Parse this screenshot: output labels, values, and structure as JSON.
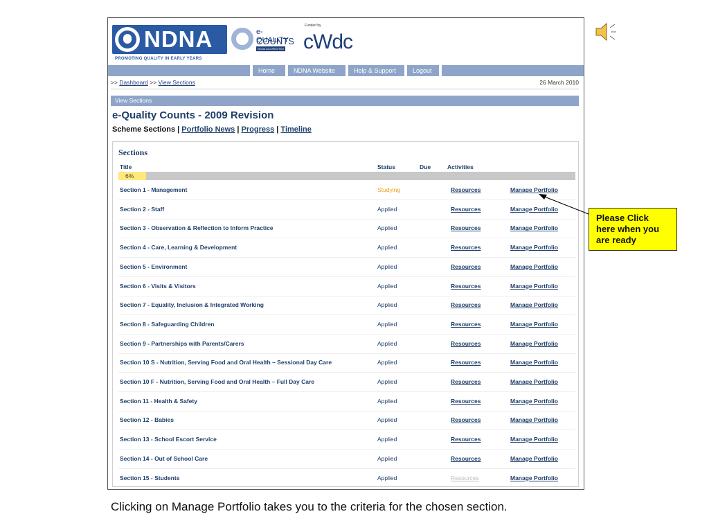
{
  "logos": {
    "ndna_text": "NDNA",
    "ndna_tagline": "PROMOTING QUALITY IN EARLY YEARS",
    "eqc_line1": "e-QUALITY",
    "eqc_line2": "COUNTS",
    "eqc_line3": "NDNA ACCREDITED",
    "funded_by": "Funded by",
    "cwdc_text": "cWdc"
  },
  "nav": {
    "items": [
      "Home",
      "NDNA Website",
      "Help & Support",
      "Logout"
    ]
  },
  "breadcrumb": {
    "prefix": ">>",
    "dashboard": "Dashboard",
    "sep": ">>",
    "view_sections": "View Sections",
    "date": "26 March 2010"
  },
  "view_bar": "View Sections",
  "page_title": "e-Quality Counts - 2009 Revision",
  "sub_nav": {
    "scheme_sections": "Scheme Sections",
    "sep": "|",
    "portfolio_news": "Portfolio News",
    "progress": "Progress",
    "timeline": "Timeline"
  },
  "sections_panel": {
    "heading": "Sections",
    "columns": {
      "title": "Title",
      "status": "Status",
      "due": "Due",
      "activities": "Activities"
    },
    "progress_label": "6%",
    "progress_fraction": 0.06,
    "rows": [
      {
        "title": "Section 1 - Management",
        "status": "Studying",
        "resources": "Resources",
        "manage": "Manage Portfolio"
      },
      {
        "title": "Section 2 - Staff",
        "status": "Applied",
        "resources": "Resources",
        "manage": "Manage Portfolio"
      },
      {
        "title": "Section 3 - Observation & Reflection to Inform Practice",
        "status": "Applied",
        "resources": "Resources",
        "manage": "Manage Portfolio"
      },
      {
        "title": "Section 4 - Care, Learning & Development",
        "status": "Applied",
        "resources": "Resources",
        "manage": "Manage Portfolio"
      },
      {
        "title": "Section 5 - Environment",
        "status": "Applied",
        "resources": "Resources",
        "manage": "Manage Portfolio"
      },
      {
        "title": "Section 6 - Visits & Visitors",
        "status": "Applied",
        "resources": "Resources",
        "manage": "Manage Portfolio"
      },
      {
        "title": "Section 7 - Equality, Inclusion & Integrated Working",
        "status": "Applied",
        "resources": "Resources",
        "manage": "Manage Portfolio"
      },
      {
        "title": "Section 8 - Safeguarding Children",
        "status": "Applied",
        "resources": "Resources",
        "manage": "Manage Portfolio"
      },
      {
        "title": "Section 9 - Partnerships with Parents/Carers",
        "status": "Applied",
        "resources": "Resources",
        "manage": "Manage Portfolio"
      },
      {
        "title": "Section 10 S - Nutrition, Serving Food and Oral Health – Sessional Day Care",
        "status": "Applied",
        "resources": "Resources",
        "manage": "Manage Portfolio"
      },
      {
        "title": "Section 10 F - Nutrition, Serving Food and Oral Health – Full Day Care",
        "status": "Applied",
        "resources": "Resources",
        "manage": "Manage Portfolio"
      },
      {
        "title": "Section 11 - Health & Safety",
        "status": "Applied",
        "resources": "Resources",
        "manage": "Manage Portfolio"
      },
      {
        "title": "Section 12 - Babies",
        "status": "Applied",
        "resources": "Resources",
        "manage": "Manage Portfolio"
      },
      {
        "title": "Section 13 - School Escort Service",
        "status": "Applied",
        "resources": "Resources",
        "manage": "Manage Portfolio"
      },
      {
        "title": "Section 14 - Out of School Care",
        "status": "Applied",
        "resources": "Resources",
        "manage": "Manage Portfolio"
      },
      {
        "title": "Section 15 - Students",
        "status": "Applied",
        "resources": "Resources",
        "manage": "Manage Portfolio",
        "resources_disabled": true
      }
    ]
  },
  "callout": "Please Click here when you are ready",
  "caption": "Clicking on Manage Portfolio takes you to the criteria for the chosen section.",
  "colors": {
    "brand_blue": "#2b5aa5",
    "nav_bar": "#8ea5c9",
    "studying": "#e8a21c",
    "callout": "#ffff00"
  },
  "icons": {
    "speaker": "speaker-icon"
  }
}
